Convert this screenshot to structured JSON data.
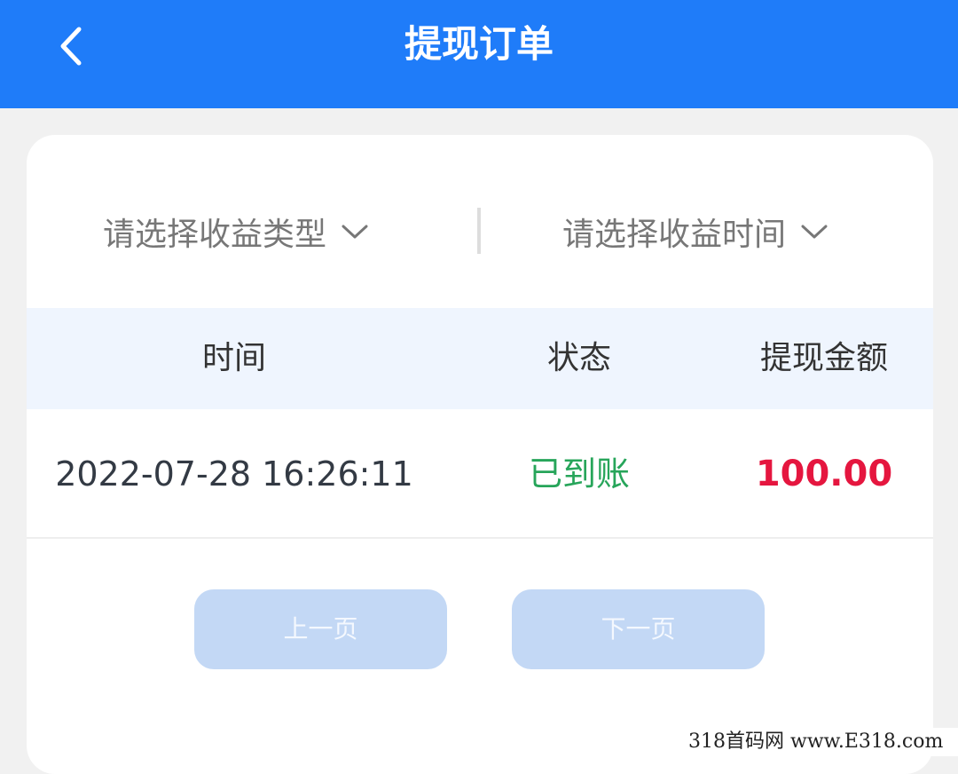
{
  "header": {
    "title": "提现订单",
    "back_icon": "chevron-left-icon",
    "background": "#1f7cf9"
  },
  "filters": {
    "type_label": "请选择收益类型",
    "time_label": "请选择收益时间",
    "dropdown_icon": "chevron-down-icon"
  },
  "table": {
    "columns": [
      "时间",
      "状态",
      "提现金额"
    ],
    "rows": [
      {
        "time": "2022-07-28 16:26:11",
        "status": "已到账",
        "amount": "100.00"
      }
    ],
    "status_color": "#27a55a",
    "amount_color": "#e5163f"
  },
  "pagination": {
    "prev_label": "上一页",
    "next_label": "下一页"
  },
  "watermark": "318首码网 www.E318.com"
}
